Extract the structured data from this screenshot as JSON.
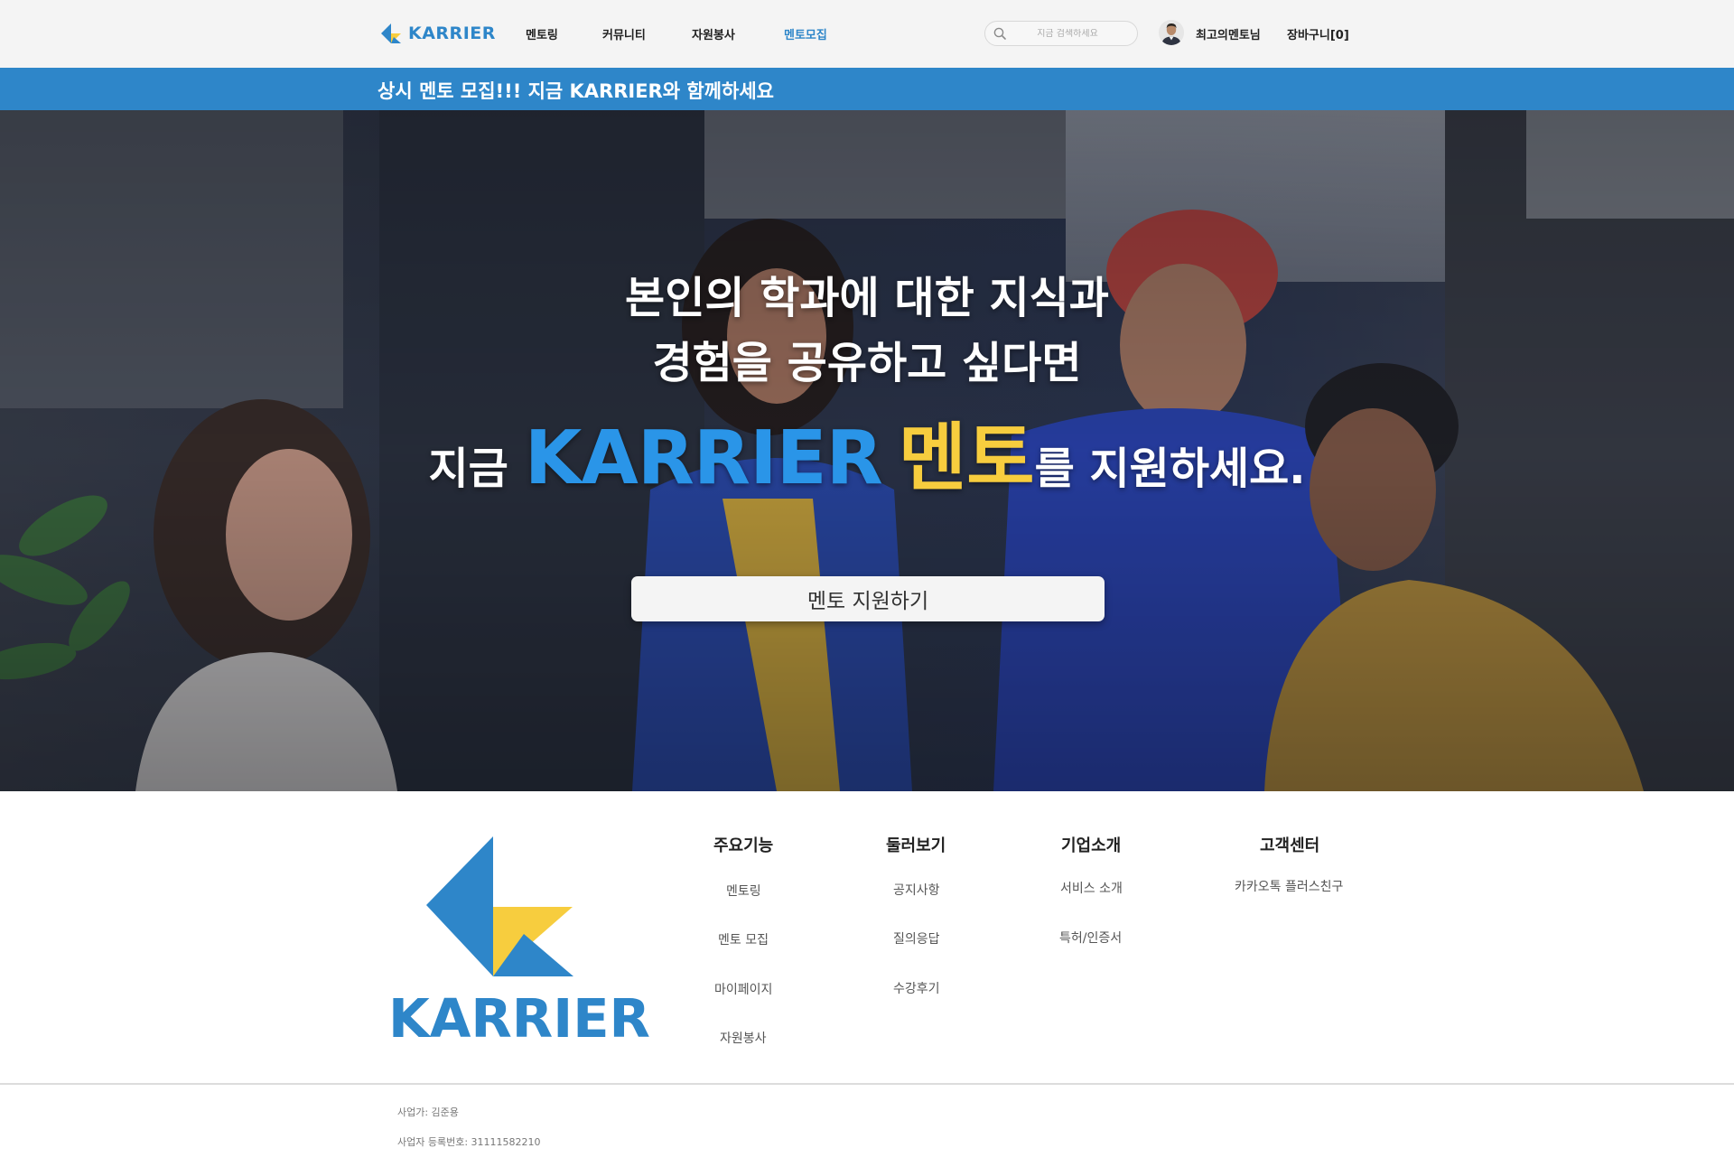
{
  "brand": {
    "name": "KARRIER"
  },
  "nav": {
    "items": [
      {
        "label": "멘토링"
      },
      {
        "label": "커뮤니티"
      },
      {
        "label": "자원봉사"
      },
      {
        "label": "멘토모집"
      }
    ],
    "active_index": 3,
    "search_placeholder": "지금 검색하세요",
    "user_name": "최고의멘토님",
    "cart_label": "장바구니[0]"
  },
  "notice": {
    "text": "상시 멘토 모집!!! 지금 KARRIER와 함께하세요"
  },
  "hero": {
    "line1": "본인의 학과에 대한 지식과",
    "line2": "경험을 공유하고 싶다면",
    "line3_prefix": "지금",
    "line3_brand": "KARRIER",
    "line3_role": "멘토",
    "line3_suffix": "를 지원하세요.",
    "cta_label": "멘토 지원하기"
  },
  "footer": {
    "logo_text": "KARRIER",
    "columns": [
      {
        "title": "주요기능",
        "links": [
          "멘토링",
          "멘토 모집",
          "마이페이지",
          "자원봉사"
        ]
      },
      {
        "title": "둘러보기",
        "links": [
          "공지사항",
          "질의응답",
          "수강후기"
        ]
      },
      {
        "title": "기업소개",
        "links": [
          "서비스 소개",
          "특허/인증서"
        ]
      },
      {
        "title": "고객센터",
        "links": [
          "카카오톡 플러스친구"
        ]
      }
    ],
    "business": {
      "owner": "사업가: 김준용",
      "registration": "사업자 등록번호: 31111582210"
    }
  },
  "colors": {
    "primary": "#2e86c9",
    "hero_brand": "#2a95e8",
    "accent_yellow": "#f7cd3e",
    "nav_bg": "#f4f4f4"
  },
  "icons": [
    "karrier-logo-icon",
    "search-icon",
    "avatar-icon"
  ]
}
